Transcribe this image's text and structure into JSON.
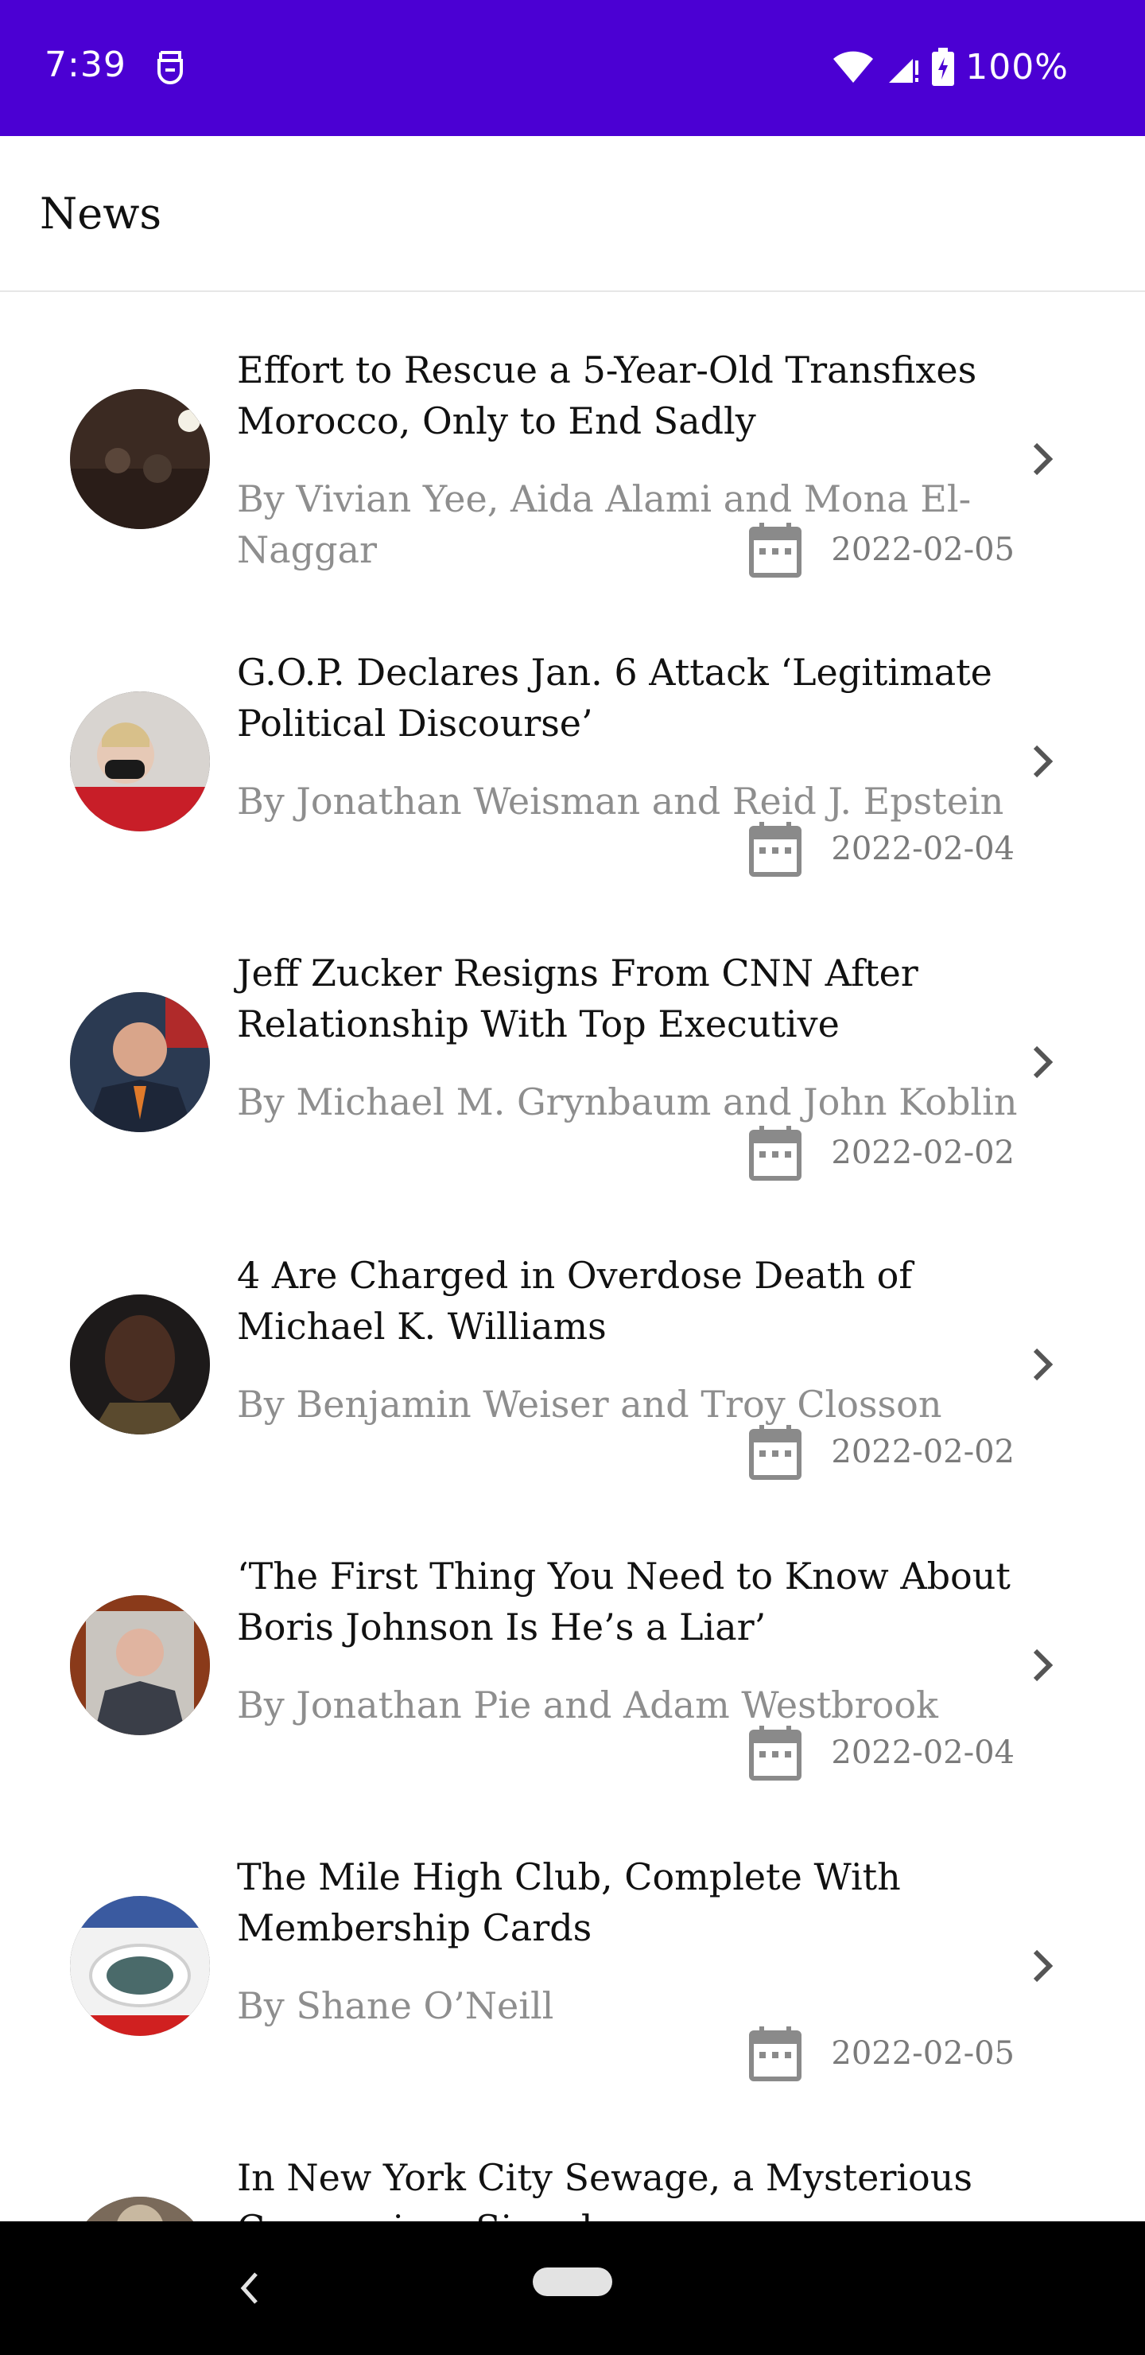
{
  "status": {
    "time": "7:39",
    "battery": "100%"
  },
  "app_bar": {
    "title": "News"
  },
  "articles": [
    {
      "title": "Effort to Rescue a 5-Year-Old Transfixes Morocco, Only to End Sadly",
      "byline": "By Vivian Yee, Aida Alami and Mona El-Naggar",
      "date": "2022-02-05"
    },
    {
      "title": "G.O.P. Declares Jan. 6 Attack ‘Legitimate Political Discourse’",
      "byline": "By Jonathan Weisman and Reid J. Epstein",
      "date": "2022-02-04"
    },
    {
      "title": "Jeff Zucker Resigns From CNN After Relationship With Top Executive",
      "byline": "By Michael M. Grynbaum and John Koblin",
      "date": "2022-02-02"
    },
    {
      "title": "4 Are Charged in Overdose Death of Michael K. Williams",
      "byline": "By Benjamin Weiser and Troy Closson",
      "date": "2022-02-02"
    },
    {
      "title": "‘The First Thing You Need to Know About Boris Johnson Is He’s a Liar’",
      "byline": "By Jonathan Pie and Adam Westbrook",
      "date": "2022-02-04"
    },
    {
      "title": "The Mile High Club, Complete With Membership Cards",
      "byline": "By Shane O’Neill",
      "date": "2022-02-05"
    },
    {
      "title": "In New York City Sewage, a Mysterious Coronavirus Signal",
      "byline": "",
      "date": ""
    }
  ],
  "icons": {
    "date": "calendar-icon",
    "open": "chevron-right-icon",
    "back": "back-icon"
  },
  "colors": {
    "status_bar": "#4b00d3",
    "title_text": "#111111",
    "byline_text": "#8e8e8e",
    "nav_bar": "#000000"
  }
}
